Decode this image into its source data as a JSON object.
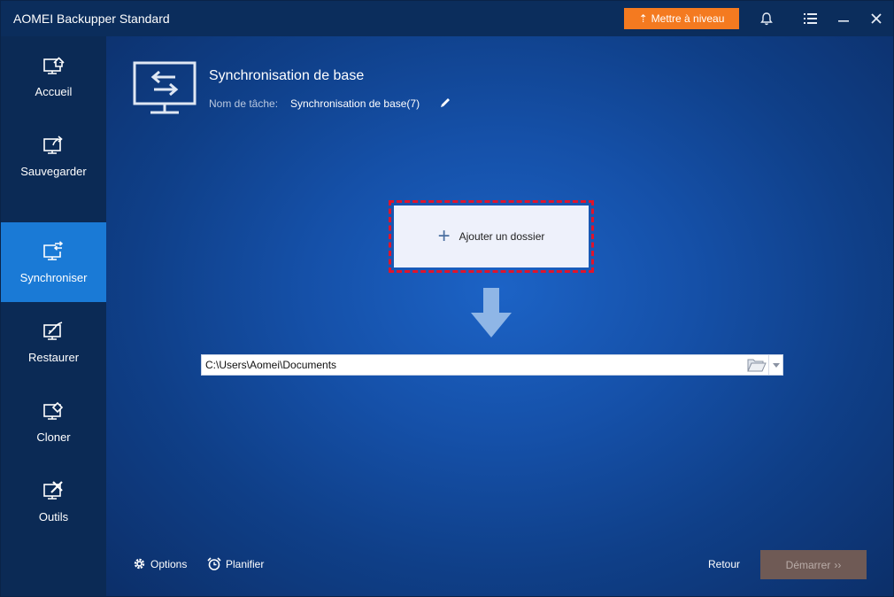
{
  "window": {
    "title": "AOMEI Backupper Standard",
    "upgrade_label": "Mettre à niveau",
    "accent_color": "#1a7ad6",
    "upgrade_color": "#f47a20"
  },
  "sidebar": {
    "items": [
      {
        "label": "Accueil",
        "icon": "home-icon",
        "active": false
      },
      {
        "label": "Sauvegarder",
        "icon": "backup-icon",
        "active": false
      },
      {
        "label": "Synchroniser",
        "icon": "sync-icon",
        "active": true
      },
      {
        "label": "Restaurer",
        "icon": "restore-icon",
        "active": false
      },
      {
        "label": "Cloner",
        "icon": "clone-icon",
        "active": false
      },
      {
        "label": "Outils",
        "icon": "tools-icon",
        "active": false
      }
    ]
  },
  "main": {
    "title": "Synchronisation de base",
    "task_name_label": "Nom de tâche:",
    "task_name_value": "Synchronisation de base(7)",
    "add_folder_label": "Ajouter un dossier",
    "destination_path": "C:\\Users\\Aomei\\Documents"
  },
  "footer": {
    "options_label": "Options",
    "schedule_label": "Planifier",
    "return_label": "Retour",
    "start_label": "Démarrer",
    "start_chevrons": "››"
  }
}
